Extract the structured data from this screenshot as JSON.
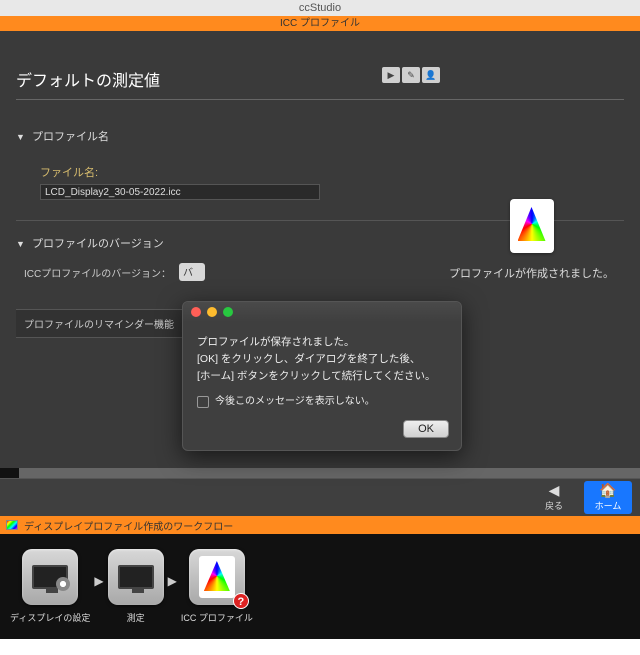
{
  "mac_title": "ccStudio",
  "window_title": "ICC プロファイル",
  "page_title": "デフォルトの測定値",
  "sections": {
    "profile_name": "プロファイル名",
    "profile_version": "プロファイルのバージョン"
  },
  "fields": {
    "filename_label": "ファイル名:",
    "filename_value": "LCD_Display2_30-05-2022.icc",
    "version_label": "ICCプロファイルのバージョン：",
    "version_value": "バ",
    "reminder_label": "プロファイルのリマインダー機能"
  },
  "profile_created_text": "プロファイルが作成されました。",
  "dialog": {
    "line1": "プロファイルが保存されました。",
    "line2": "[OK] をクリックし、ダイアログを終了した後、",
    "line3": "[ホーム] ボタンをクリックして続行してください。",
    "checkbox_label": "今後このメッセージを表示しない。",
    "ok": "OK"
  },
  "nav": {
    "back": "戻る",
    "home": "ホーム"
  },
  "workflow": {
    "title": "ディスプレイプロファイル作成のワークフロー",
    "steps": {
      "display_settings": "ディスプレイの設定",
      "measure": "測定",
      "icc_profile": "ICC プロファイル"
    }
  }
}
